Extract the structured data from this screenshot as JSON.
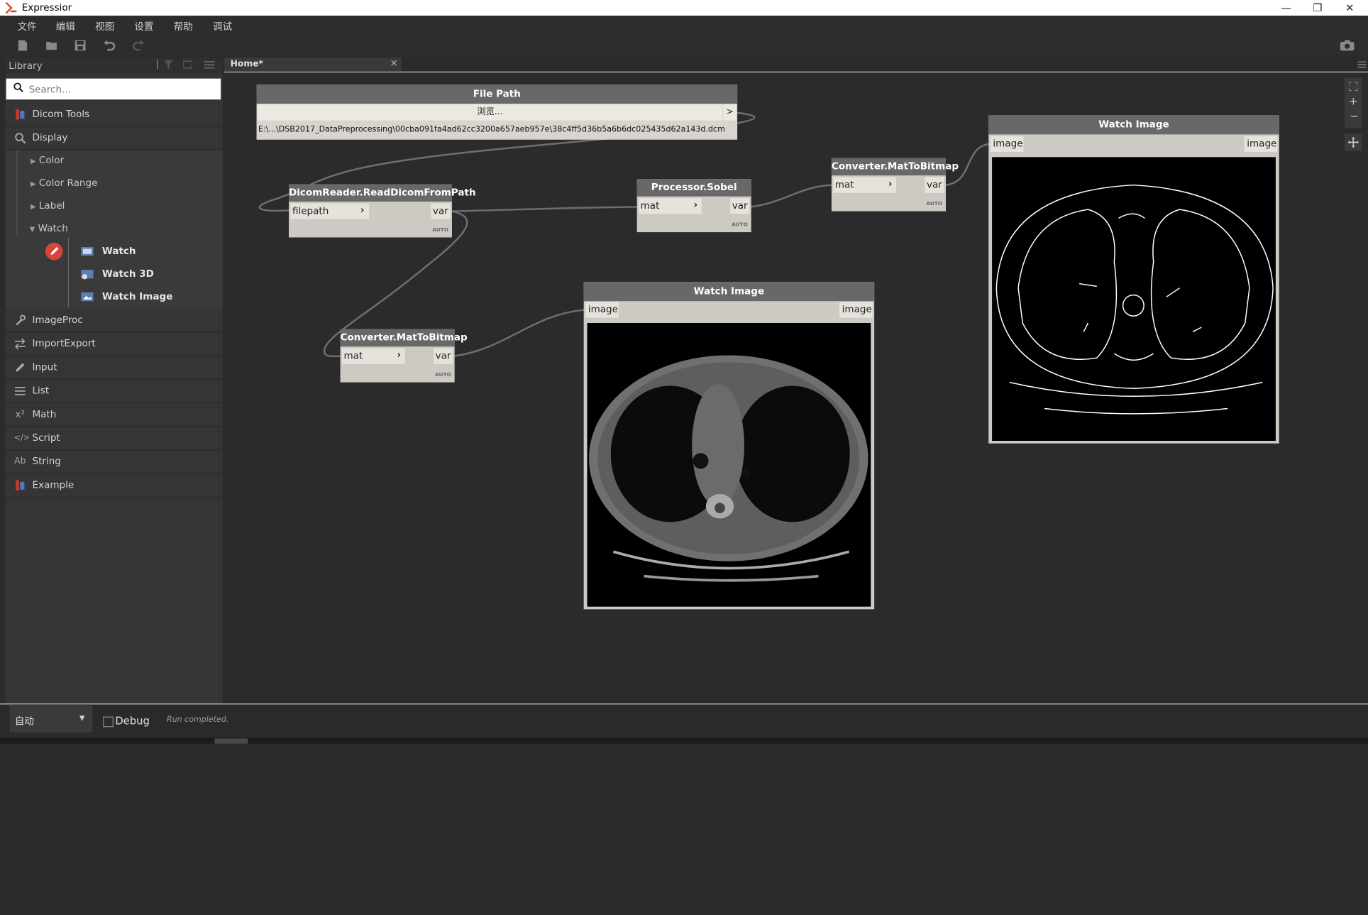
{
  "window": {
    "title": "Expressior",
    "controls": [
      "—",
      "❐",
      "✕"
    ]
  },
  "menu": [
    "文件",
    "编辑",
    "视图",
    "设置",
    "帮助",
    "调试"
  ],
  "library": {
    "header": "Library",
    "search_placeholder": "Search...",
    "categories": [
      {
        "label": "Dicom Tools",
        "icon": "dicom-icon"
      },
      {
        "label": "Display",
        "icon": "magnifier-icon"
      },
      {
        "label": "ImageProc",
        "icon": "wrench-icon"
      },
      {
        "label": "ImportExport",
        "icon": "arrows-icon"
      },
      {
        "label": "Input",
        "icon": "pencil-icon"
      },
      {
        "label": "List",
        "icon": "list-icon"
      },
      {
        "label": "Math",
        "icon": "x-squared-icon"
      },
      {
        "label": "Script",
        "icon": "code-icon"
      },
      {
        "label": "String",
        "icon": "ab-icon"
      },
      {
        "label": "Example",
        "icon": "example-icon"
      }
    ],
    "display_subs": [
      "Color",
      "Color Range",
      "Label",
      "Watch"
    ],
    "watch_items": [
      "Watch",
      "Watch 3D",
      "Watch Image"
    ]
  },
  "tab": {
    "label": "Home*"
  },
  "nodes": {
    "filepath": {
      "title": "File Path",
      "browse": "浏览...",
      "arrow": ">",
      "path": "E:\\...\\DSB2017_DataPreprocessing\\00cba091fa4ad62cc3200a657aeb957e\\38c4ff5d36b5a6b6dc025435d62a143d.dcm"
    },
    "reader": {
      "title": "DicomReader.ReadDicomFromPath",
      "in": "filepath",
      "out": "var",
      "auto": "AUTO"
    },
    "sobel": {
      "title": "Processor.Sobel",
      "in": "mat",
      "out": "var",
      "auto": "AUTO"
    },
    "conv_top": {
      "title": "Converter.MatToBitmap",
      "in": "mat",
      "out": "var",
      "auto": "AUTO"
    },
    "conv_bottom": {
      "title": "Converter.MatToBitmap",
      "in": "mat",
      "out": "var",
      "auto": "AUTO"
    },
    "watch_center": {
      "title": "Watch Image",
      "in": "image",
      "out": "image"
    },
    "watch_right": {
      "title": "Watch Image",
      "in": "image",
      "out": "image"
    }
  },
  "bottom": {
    "run_mode": "自动",
    "debug_label": "Debug",
    "status": "Run completed."
  },
  "colors": {
    "canvas": "#2b2b2b",
    "node_body": "#cdcac4",
    "node_header": "#686868",
    "edge": "#6f6f6f"
  }
}
